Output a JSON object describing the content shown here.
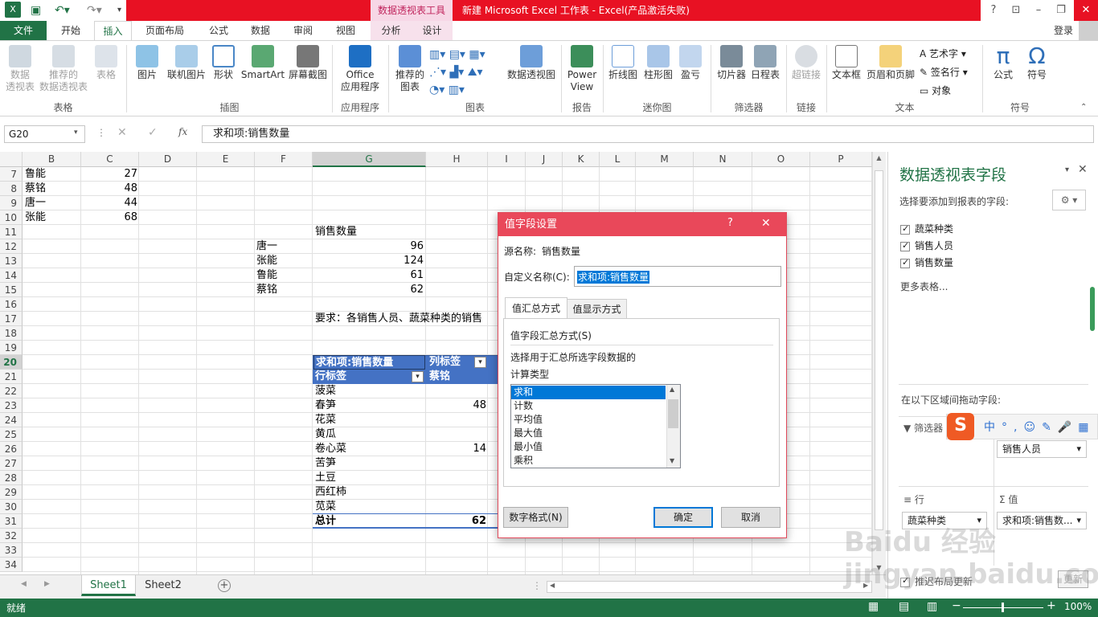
{
  "app": {
    "title": "新建 Microsoft Excel 工作表 - Excel(产品激活失败)",
    "context_tab_title": "数据透视表工具",
    "window_buttons": [
      "?",
      "⊡",
      "–",
      "❐"
    ],
    "login": "登录"
  },
  "tabs": [
    "文件",
    "开始",
    "插入",
    "页面布局",
    "公式",
    "数据",
    "审阅",
    "视图",
    "分析",
    "设计"
  ],
  "ribbon": {
    "groups": [
      {
        "label": "表格",
        "buttons": [
          "数据\n透视表",
          "推荐的\n数据透视表",
          "表格"
        ]
      },
      {
        "label": "插图",
        "buttons": [
          "图片",
          "联机图片",
          "形状",
          "SmartArt",
          "屏幕截图"
        ]
      },
      {
        "label": "应用程序",
        "buttons": [
          "Office\n应用程序"
        ]
      },
      {
        "label": "图表",
        "buttons": [
          "推荐的\n图表",
          "数据透视图"
        ]
      },
      {
        "label": "报告",
        "buttons": [
          "Power\nView"
        ]
      },
      {
        "label": "迷你图",
        "buttons": [
          "折线图",
          "柱形图",
          "盈亏"
        ]
      },
      {
        "label": "筛选器",
        "buttons": [
          "切片器",
          "日程表"
        ]
      },
      {
        "label": "链接",
        "buttons": [
          "超链接"
        ]
      },
      {
        "label": "文本",
        "buttons": [
          "文本框",
          "页眉和页脚",
          "艺术字",
          "签名行",
          "对象"
        ]
      },
      {
        "label": "符号",
        "buttons": [
          "公式",
          "符号"
        ]
      }
    ]
  },
  "formula_bar": {
    "name_box": "G20",
    "fx": "fx",
    "content": "求和项:销售数量"
  },
  "columns": [
    "B",
    "C",
    "D",
    "E",
    "F",
    "G",
    "H",
    "I",
    "J",
    "K",
    "L",
    "M",
    "N",
    "O",
    "P"
  ],
  "rows": [
    "7",
    "8",
    "9",
    "10",
    "11",
    "12",
    "13",
    "14",
    "15",
    "16",
    "17",
    "18",
    "19",
    "20",
    "21",
    "22",
    "23",
    "24",
    "25",
    "26",
    "27",
    "28",
    "29",
    "30",
    "31",
    "32",
    "33",
    "34"
  ],
  "cells": {
    "b7": "鲁能",
    "c7": "27",
    "b8": "蔡铭",
    "c8": "48",
    "b9": "唐一",
    "c9": "44",
    "b10": "张能",
    "c10": "68",
    "g11": "销售数量",
    "f12": "唐一",
    "g12": "96",
    "f13": "张能",
    "g13": "124",
    "f14": "鲁能",
    "g14": "61",
    "f15": "蔡铭",
    "g15": "62",
    "g17": "要求：各销售人员、蔬菜种类的销售"
  },
  "pivot": {
    "sum_label": "求和项:销售数量",
    "col_label": "列标签",
    "row_label": "行标签",
    "col_first": "蔡铭",
    "rows": [
      {
        "name": "菠菜",
        "v": ""
      },
      {
        "name": "春笋",
        "v": "48"
      },
      {
        "name": "花菜",
        "v": ""
      },
      {
        "name": "黄瓜",
        "v": ""
      },
      {
        "name": "卷心菜",
        "v": "14"
      },
      {
        "name": "苦笋",
        "v": ""
      },
      {
        "name": "土豆",
        "v": ""
      },
      {
        "name": "西红柿",
        "v": ""
      },
      {
        "name": "苋菜",
        "v": ""
      }
    ],
    "total_label": "总计",
    "total_value": "62"
  },
  "sheets": [
    "Sheet1",
    "Sheet2"
  ],
  "status": {
    "ready": "就绪",
    "zoom": "100%"
  },
  "pane": {
    "title": "数据透视表字段",
    "subtitle": "选择要添加到报表的字段:",
    "fields": [
      "蔬菜种类",
      "销售人员",
      "销售数量"
    ],
    "more": "更多表格...",
    "drag_hint": "在以下区域间拖动字段:",
    "filter_label": "筛选器",
    "columns_dd": "销售人员",
    "rows_label": "行",
    "values_label": "值",
    "rows_dd": "蔬菜种类",
    "values_dd": "求和项:销售数...",
    "defer": "推迟布局更新",
    "update": "更新"
  },
  "dialog": {
    "title": "值字段设置",
    "help": "?",
    "close": "✕",
    "source_label": "源名称:",
    "source_value": "销售数量",
    "custom_label": "自定义名称(C):",
    "custom_value": "求和项:销售数量",
    "tabs": [
      "值汇总方式",
      "值显示方式"
    ],
    "section": "值字段汇总方式(S)",
    "desc1": "选择用于汇总所选字段数据的",
    "desc2": "计算类型",
    "list": [
      "求和",
      "计数",
      "平均值",
      "最大值",
      "最小值",
      "乘积"
    ],
    "number_format": "数字格式(N)",
    "ok": "确定",
    "cancel": "取消"
  },
  "ime": {
    "items": [
      "中",
      "°,",
      "☺",
      "✎",
      "🎤",
      "▦"
    ]
  },
  "watermark": "Baidu 经验  jingyan.baidu.com",
  "colors": {
    "excel_green": "#217346",
    "title_red": "#e81123",
    "pivot_blue": "#4472c4",
    "dialog_red": "#e9485a",
    "selected_blue": "#0078d7"
  }
}
